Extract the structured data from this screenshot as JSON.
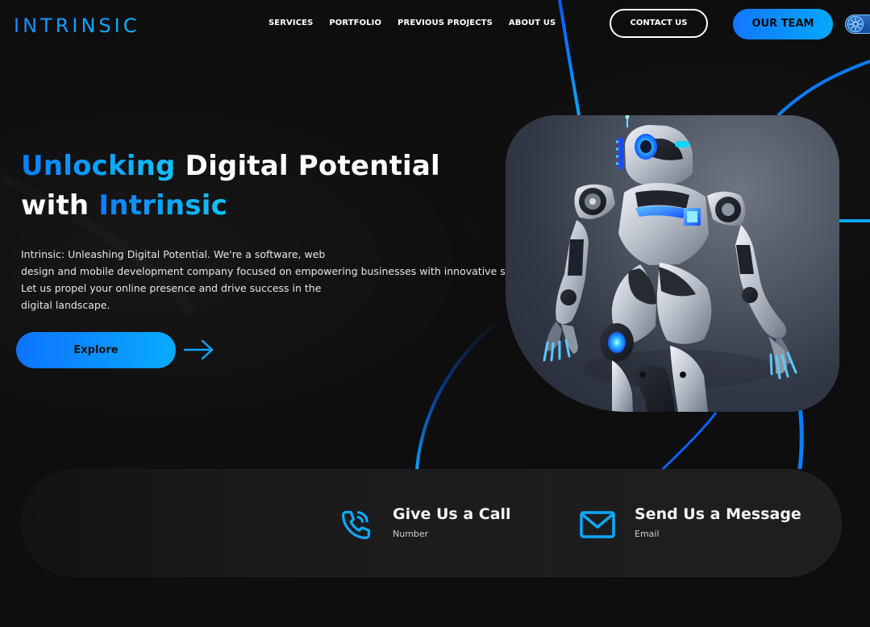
{
  "brand": {
    "logo_text": "INTRINSIC"
  },
  "nav": {
    "items": [
      {
        "label": "SERVICES"
      },
      {
        "label": "PORTFOLIO"
      },
      {
        "label": "PREVIOUS PROJECTS"
      },
      {
        "label": "ABOUT US"
      }
    ]
  },
  "header": {
    "contact_label": "CONTACT US",
    "team_label": "OUR TEAM",
    "theme_toggle_icon": "sun-icon"
  },
  "hero": {
    "title": {
      "line1": {
        "accent": "Unlocking",
        "rest": "Digital Potential"
      },
      "line2": {
        "prefix": "with",
        "accent": "Intrinsic"
      }
    },
    "description": {
      "line1": "Intrinsic: Unleashing Digital Potential. We're a software, web",
      "line2": "design and mobile development company focused on empowering businesses with innovative solutions.",
      "line3": "Let us propel your online presence and drive success in the",
      "line4": "digital landscape."
    },
    "cta_label": "Explore",
    "cta_icon": "arrow-right-icon",
    "image_subject": "robot-illustration"
  },
  "contact": {
    "call": {
      "title": "Give Us a Call",
      "subtitle": "Number",
      "icon": "phone-icon"
    },
    "message": {
      "title": "Send Us a Message",
      "subtitle": "Email",
      "icon": "mail-icon"
    }
  },
  "colors": {
    "background": "#0e0e0f",
    "accent_start": "#0e73ff",
    "accent_end": "#08abff",
    "text": "#ffffff"
  }
}
